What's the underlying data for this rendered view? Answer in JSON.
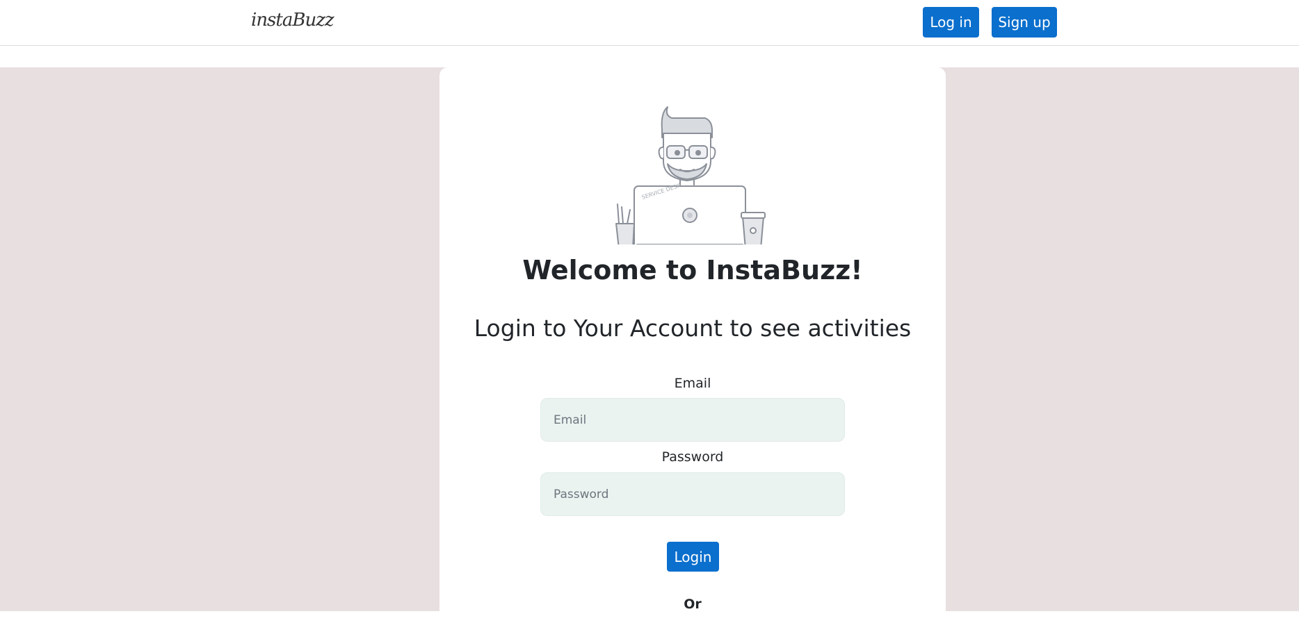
{
  "navbar": {
    "brand": "instaBuzz",
    "login_label": "Log in",
    "signup_label": "Sign up"
  },
  "card": {
    "welcome": "Welcome to InstaBuzz!",
    "subtitle": "Login to Your Account to see activities",
    "illustration": {
      "name": "developer-at-laptop-illustration",
      "laptop_sticker": "SERVICE DESK"
    },
    "form": {
      "email_label": "Email",
      "email_placeholder": "Email",
      "email_value": "",
      "password_label": "Password",
      "password_placeholder": "Password",
      "password_value": "",
      "submit_label": "Login"
    },
    "or_text": "Or"
  },
  "colors": {
    "primary": "#0a6fcd",
    "background": "#e8dfe1",
    "input_bg": "#eaf3f0",
    "text": "#212529"
  }
}
